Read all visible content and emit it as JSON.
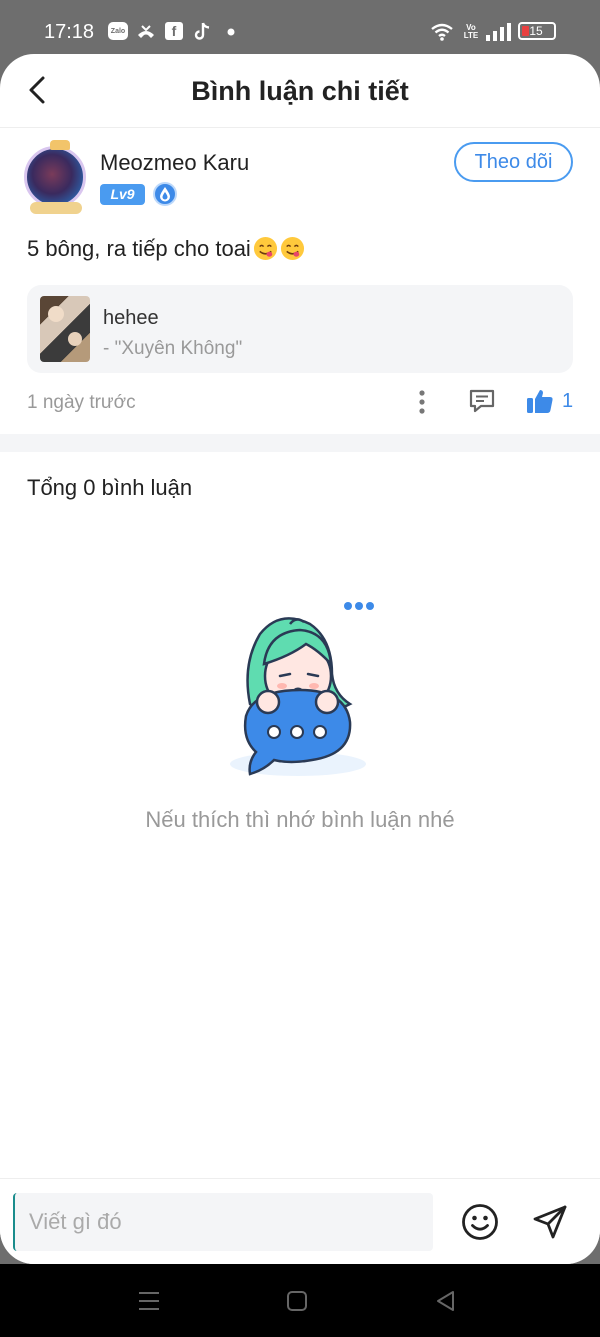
{
  "status_bar": {
    "time": "17:18",
    "zalo_label": "Zalo",
    "facebook_label": "f",
    "battery_level": "15",
    "network_top": "Vo",
    "network_bottom": "LTE"
  },
  "header": {
    "title": "Bình luận chi tiết"
  },
  "post": {
    "username": "Meozmeo Karu",
    "level": "Lv9",
    "follow_label": "Theo dõi",
    "comment": "5 bông, ra tiếp cho toai",
    "emoji_count": 2,
    "quote": {
      "title": "hehee",
      "source": "- \"Xuyên Không\""
    },
    "time_ago": "1 ngày trước",
    "like_count": "1"
  },
  "comments": {
    "total_label": "Tổng 0 bình luận",
    "empty_text": "Nếu thích thì nhớ bình luận nhé"
  },
  "input": {
    "placeholder": "Viết gì đó"
  },
  "colors": {
    "accent": "#3d8ae8",
    "secondary_text": "#999999",
    "card_background": "#f4f5f7",
    "illustration_hair": "#5fdcb0",
    "illustration_bubble": "#3d8ae8"
  }
}
